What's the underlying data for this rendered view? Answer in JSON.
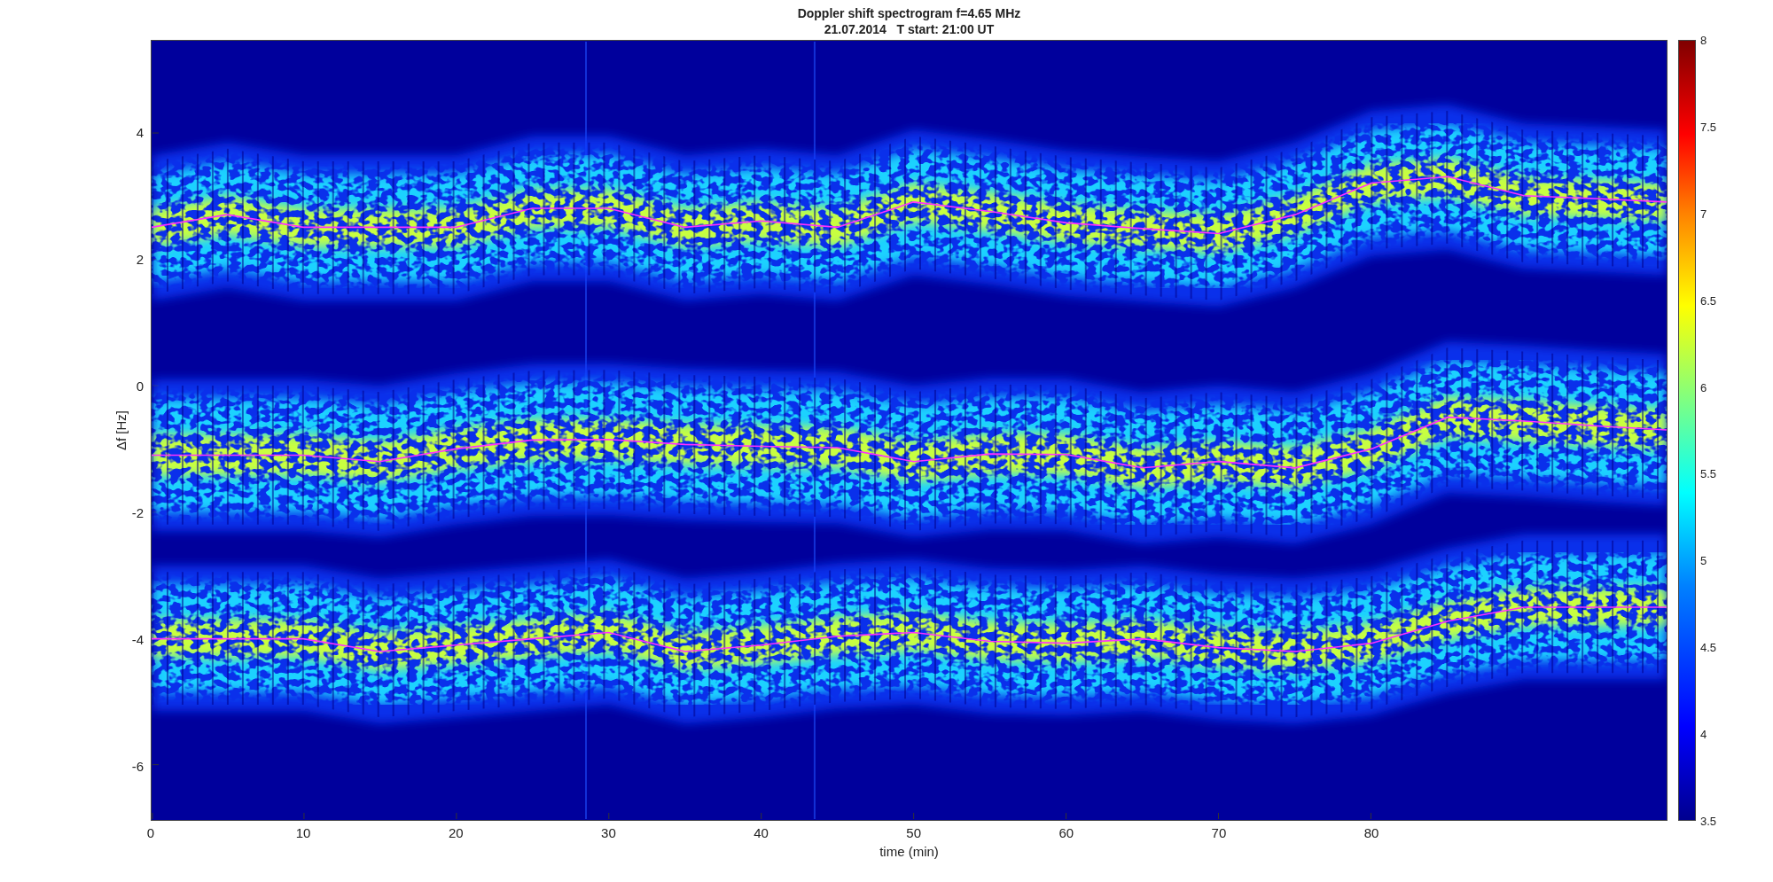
{
  "figure": {
    "title_lines": [
      "Doppler shift spectrogram f=4.65 MHz",
      "21.07.2014   T start: 21:00 UT"
    ],
    "chart_data": {
      "type": "line",
      "xlabel": "time (min)",
      "ylabel": "Δf [Hz]",
      "xlim": [
        0,
        99.4
      ],
      "ylim": [
        -6.875,
        5.46
      ],
      "xticks": [
        0,
        10,
        20,
        30,
        40,
        50,
        60,
        70,
        80
      ],
      "yticks": [
        4,
        2,
        0,
        -2,
        -4,
        -6
      ],
      "x": [
        0,
        5,
        10,
        15,
        20,
        25,
        30,
        35,
        40,
        45,
        50,
        55,
        60,
        65,
        70,
        75,
        80,
        85,
        90,
        95,
        99.4
      ],
      "series": [
        {
          "color": "#ff30ff",
          "values": [
            2.5,
            2.7,
            2.5,
            2.5,
            2.5,
            2.8,
            2.8,
            2.5,
            2.6,
            2.5,
            2.9,
            2.75,
            2.57,
            2.48,
            2.4,
            2.7,
            3.2,
            3.3,
            3.0,
            2.95,
            2.9
          ]
        },
        {
          "color": "#ff30ff",
          "values": [
            -1.1,
            -1.1,
            -1.1,
            -1.2,
            -1.0,
            -0.86,
            -0.85,
            -0.93,
            -0.96,
            -0.98,
            -1.2,
            -1.08,
            -1.09,
            -1.3,
            -1.2,
            -1.3,
            -1.0,
            -0.5,
            -0.56,
            -0.64,
            -0.7
          ]
        },
        {
          "color": "#ff30ff",
          "values": [
            -4.0,
            -4.0,
            -4.0,
            -4.2,
            -4.1,
            -4.0,
            -3.9,
            -4.2,
            -4.1,
            -3.96,
            -3.9,
            -4.04,
            -4.07,
            -4.0,
            -4.14,
            -4.2,
            -4.07,
            -3.72,
            -3.5,
            -3.5,
            -3.5
          ]
        }
      ]
    },
    "colorbar_ticks": [
      "8",
      "7.5",
      "7",
      "6.5",
      "6",
      "5.5",
      "5",
      "4.5",
      "4",
      "3.5"
    ]
  }
}
